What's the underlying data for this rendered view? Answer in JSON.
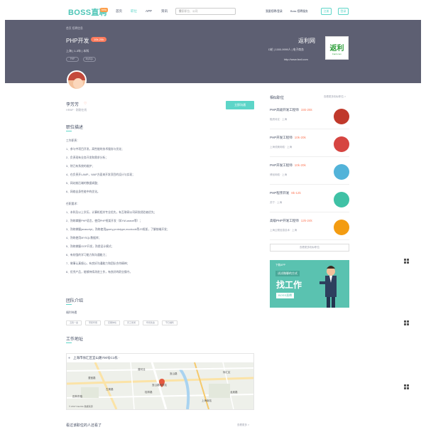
{
  "nav": {
    "logo": "BOSS直聘",
    "logo_badge": "beta",
    "items": [
      "首页",
      "职位",
      "APP",
      "资讯"
    ],
    "search_placeholder": "搜索职位、公司",
    "employer_link": "我要招聘/登录",
    "boss_link": "Boss 招聘服务",
    "login": "注册",
    "register": "登录"
  },
  "job": {
    "breadcrumb": "首页  招聘信息",
    "title": "PHP开发",
    "salary": "10k-20k",
    "meta": "上海  |  1-3年  |  本科",
    "tags": [
      "PHP",
      "MySQL"
    ]
  },
  "company": {
    "name": "返利网",
    "meta": "D轮  |  1000-9999人  |  电子商务",
    "url": "http://www.fanli.com",
    "logo_text": "返利",
    "logo_sub": "Fanli.com"
  },
  "boss": {
    "name": "李芳芳",
    "title": "HRBP · 刚刚在线",
    "chat_button": "立即沟通"
  },
  "description": {
    "title": "职位描述",
    "lines": [
      "工作职责：",
      "1、参与中项目开发，高性能的技术服务与优化；",
      "2、负责现有业务开发和需求分析；",
      "3、除已有系统的维护；",
      "4、在负责开LAMP，WAP方面来开发项目的设计与实现；",
      "5、网站前后端的数据调整；",
      "6、网络自身性能中的优化。",
      "",
      "任职要求：",
      "1、本科及以上学历，计算机相关专业优先，有互联网公司研发经验者优先；",
      "2、熟练掌握PHP语言，使用PHP框架开发（如Yii/Laravel等）；",
      "3、熟练掌握javascript，熟练使用jquery,prototype,mootools等JS框架，了解前端开发；",
      "4、熟练使用MYSQL数据库；",
      "5、熟练掌握OOP开发，熟悉设计模式；",
      "6、有较强的学习能力和沟通能力；",
      "7、做事认真细心，有良好沟通能力和团队合作精神；",
      "8、优秀产品，能够持续改进工作，有良好的职业操守。"
    ]
  },
  "team": {
    "title": "团队介绍",
    "subtitle": "福利待遇",
    "tags": [
      "五险一金",
      "带薪年假",
      "定期体检",
      "员工旅游",
      "年终奖金",
      "节日福利"
    ]
  },
  "address": {
    "title": "工作地址",
    "text": "上海市徐汇区宜山路700号C1栋 ·",
    "map_labels": [
      "漕河泾",
      "漕宝路",
      "古美路",
      "宜山路",
      "桂林路",
      "徐汇区",
      "上海南站",
      "龙吴路",
      "田林东路",
      "宜山路地铁站"
    ],
    "copyright": "© 2017 NavInfo  数据来源"
  },
  "bottom": {
    "title": "看过该职位的人还看了",
    "more": "查看更多 >"
  },
  "side": {
    "title": "相似职位",
    "more": "查看更多相似职位 >",
    "jobs": [
      {
        "title": "PHP高级开发工程师",
        "salary": "15k-25k",
        "company": "融资待定 · 上海",
        "logo_color": "#c0392b"
      },
      {
        "title": "PHP开发工程师",
        "salary": "10k-20k",
        "company": "上海领美网络 · 上海",
        "logo_color": "#d64541"
      },
      {
        "title": "PHP开发工程师",
        "salary": "10k-20k",
        "company": "博创网络 · 上海",
        "logo_color": "#52b3d9"
      },
      {
        "title": "PHP程序开发",
        "salary": "8k-12k",
        "company": "苏宁 · 上海",
        "logo_color": "#3fc1a5"
      },
      {
        "title": "高级PHP开发工程师",
        "salary": "12k-24k",
        "company": "上海云霓信息技术 · 上海",
        "logo_color": "#f39c12"
      }
    ],
    "more_jobs": "查看更多相似职位"
  },
  "ad": {
    "app": "下载APP",
    "sub": "试试微聊的方式",
    "big": "找工作",
    "brand": "BOSS直聘"
  }
}
